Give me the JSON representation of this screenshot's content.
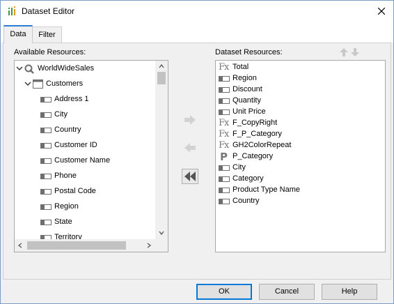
{
  "window": {
    "title": "Dataset Editor"
  },
  "tabs": [
    {
      "label": "Data",
      "active": true
    },
    {
      "label": "Filter",
      "active": false
    }
  ],
  "available": {
    "label": "Available Resources:",
    "tree": [
      {
        "label": "WorldWideSales",
        "icon": "query-icon",
        "expander": "chevron-down"
      },
      {
        "label": "Customers",
        "icon": "table-icon",
        "expander": "chevron-down"
      },
      {
        "label": "Address 1",
        "icon": "field-icon"
      },
      {
        "label": "City",
        "icon": "field-icon"
      },
      {
        "label": "Country",
        "icon": "field-icon"
      },
      {
        "label": "Customer ID",
        "icon": "field-icon"
      },
      {
        "label": "Customer Name",
        "icon": "field-icon"
      },
      {
        "label": "Phone",
        "icon": "field-icon"
      },
      {
        "label": "Postal Code",
        "icon": "field-icon"
      },
      {
        "label": "Region",
        "icon": "field-icon"
      },
      {
        "label": "State",
        "icon": "field-icon"
      },
      {
        "label": "Territory",
        "icon": "field-icon"
      }
    ]
  },
  "dataset": {
    "label": "Dataset Resources:",
    "items": [
      {
        "label": "Total",
        "icon": "formula-icon"
      },
      {
        "label": "Region",
        "icon": "field-icon"
      },
      {
        "label": "Discount",
        "icon": "field-icon"
      },
      {
        "label": "Quantity",
        "icon": "field-icon"
      },
      {
        "label": "Unit Price",
        "icon": "field-icon"
      },
      {
        "label": "F_CopyRight",
        "icon": "formula-icon"
      },
      {
        "label": "F_P_Category",
        "icon": "formula-icon"
      },
      {
        "label": "GH2ColorRepeat",
        "icon": "formula-icon"
      },
      {
        "label": "P_Category",
        "icon": "parameter-icon"
      },
      {
        "label": "City",
        "icon": "field-icon"
      },
      {
        "label": "Category",
        "icon": "field-icon"
      },
      {
        "label": "Product Type Name",
        "icon": "field-icon"
      },
      {
        "label": "Country",
        "icon": "field-icon"
      }
    ]
  },
  "buttons": {
    "ok": "OK",
    "cancel": "Cancel",
    "help": "Help"
  },
  "colors": {
    "accent": "#0078d7",
    "tab_active": "#2e7bd6",
    "disabled_icon": "#c8c8c8",
    "icon_gray": "#6e6e6e"
  }
}
